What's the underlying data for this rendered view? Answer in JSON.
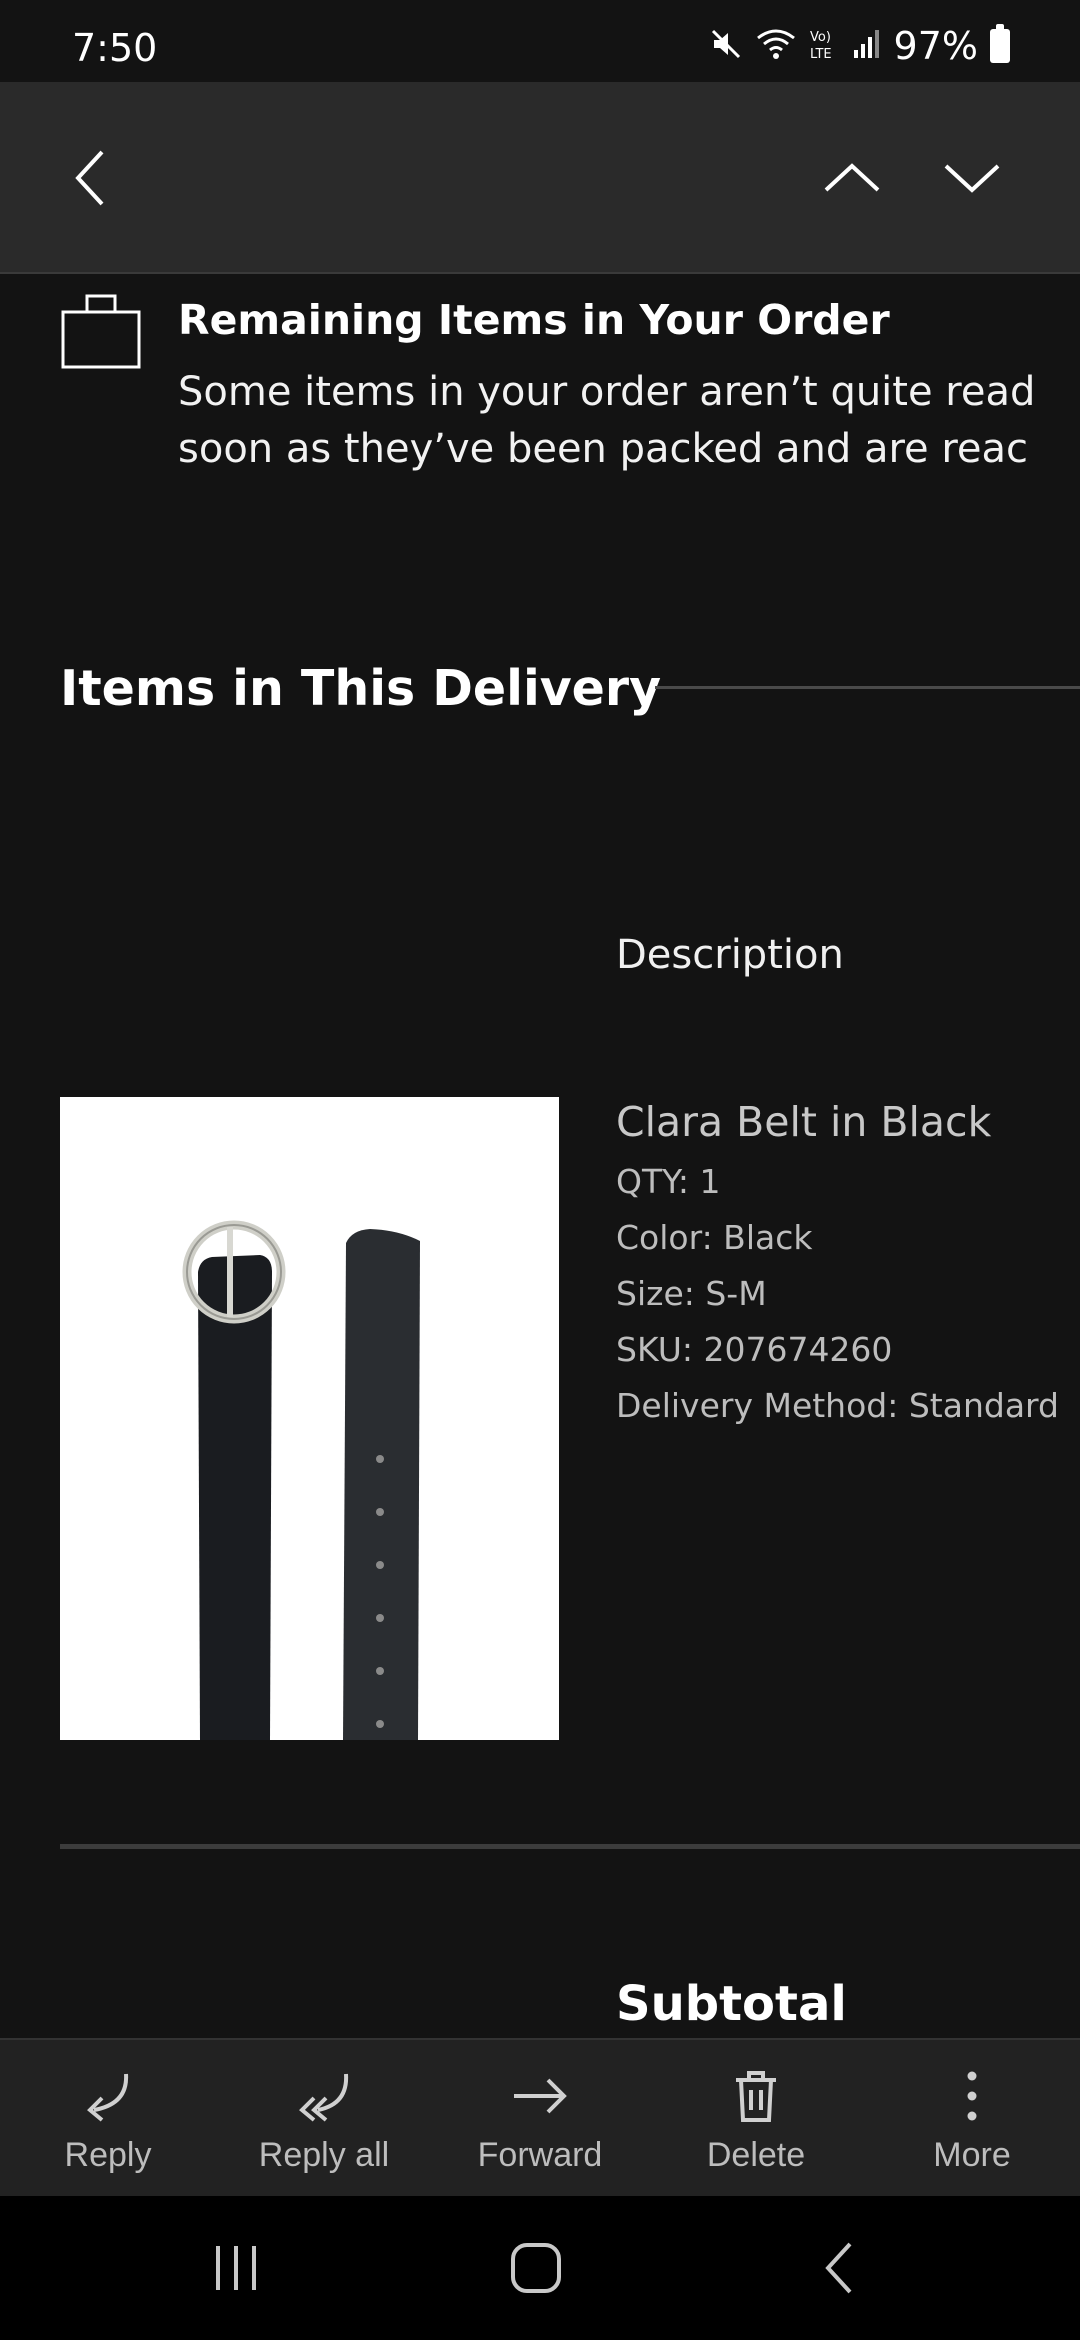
{
  "status_bar": {
    "time": "7:50",
    "battery": "97%",
    "icons": [
      "mute-icon",
      "wifi-icon",
      "volte-icon",
      "signal-icon",
      "battery-icon"
    ]
  },
  "toolbar": {
    "icons": [
      "back-icon",
      "previous-icon",
      "next-icon"
    ]
  },
  "email": {
    "remaining": {
      "title": "Remaining Items in Your Order",
      "line1": "Some items in your order aren’t quite read",
      "line2": "soon as they’ve been packed and are reac",
      "icon": "shopping-bag-icon"
    },
    "items_section_title": "Items in This Delivery",
    "description_header": "Description",
    "item": {
      "name": "Clara Belt in Black",
      "qty": "QTY: 1",
      "color": "Color: Black",
      "size": "Size: S-M",
      "sku": "SKU: 207674260",
      "delivery": "Delivery Method: Standard"
    },
    "subtotal_label": "Subtotal"
  },
  "actions": [
    {
      "label": "Reply",
      "icon": "reply-icon"
    },
    {
      "label": "Reply all",
      "icon": "reply-all-icon"
    },
    {
      "label": "Forward",
      "icon": "forward-icon"
    },
    {
      "label": "Delete",
      "icon": "trash-icon"
    },
    {
      "label": "More",
      "icon": "more-vertical-icon"
    }
  ],
  "nav": {
    "icons": [
      "recents-icon",
      "home-icon",
      "nav-back-icon"
    ]
  }
}
